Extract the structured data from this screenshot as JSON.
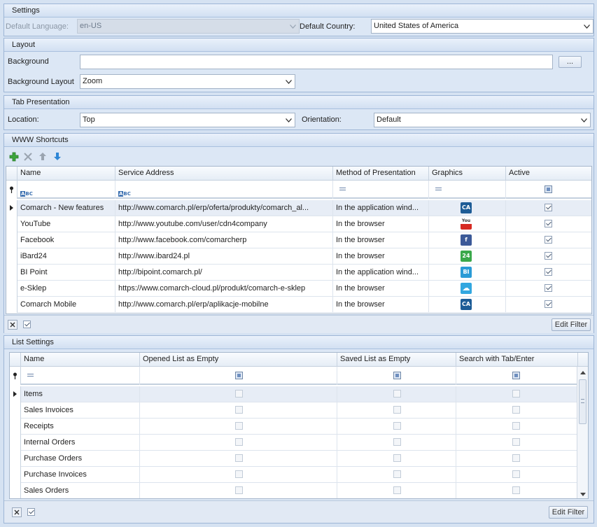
{
  "settings": {
    "header": "Settings",
    "default_language_label": "Default Language:",
    "default_language_value": "en-US",
    "default_country_label": "Default Country:",
    "default_country_value": "United States of America"
  },
  "layout": {
    "header": "Layout",
    "background_label": "Background",
    "background_value": "",
    "browse_label": "...",
    "background_layout_label": "Background Layout",
    "background_layout_value": "Zoom"
  },
  "tab_presentation": {
    "header": "Tab Presentation",
    "location_label": "Location:",
    "location_value": "Top",
    "orientation_label": "Orientation:",
    "orientation_value": "Default"
  },
  "www_shortcuts": {
    "header": "WWW Shortcuts",
    "columns": [
      "Name",
      "Service Address",
      "Method of Presentation",
      "Graphics",
      "Active"
    ],
    "rows": [
      {
        "name": "Comarch - New features",
        "address": "http://www.comarch.pl/erp/oferta/produkty/comarch_al...",
        "method": "In the application wind...",
        "icon": "comarch-ca-icon",
        "icon_text": "CA",
        "icon_color": "#1d5c96",
        "active": true
      },
      {
        "name": "YouTube",
        "address": "http://www.youtube.com/user/cdn4company",
        "method": "In the browser",
        "icon": "youtube-icon",
        "icon_text": "You",
        "icon_color": "#d62a22",
        "active": true
      },
      {
        "name": "Facebook",
        "address": "http://www.facebook.com/comarcherp",
        "method": "In the browser",
        "icon": "facebook-icon",
        "icon_text": "f",
        "icon_color": "#3b5998",
        "active": true
      },
      {
        "name": "iBard24",
        "address": "http://www.ibard24.pl",
        "method": "In the browser",
        "icon": "ibard24-icon",
        "icon_text": "24",
        "icon_color": "#3aa84a",
        "active": true
      },
      {
        "name": "BI Point",
        "address": "http://bipoint.comarch.pl/",
        "method": "In the application wind...",
        "icon": "bi-point-icon",
        "icon_text": "BI",
        "icon_color": "#2a9bd6",
        "active": true
      },
      {
        "name": "e-Sklep",
        "address": "https://www.comarch-cloud.pl/produkt/comarch-e-sklep",
        "method": "In the browser",
        "icon": "cloud-icon",
        "icon_text": "☁",
        "icon_color": "#32a7e0",
        "active": true
      },
      {
        "name": "Comarch Mobile",
        "address": "http://www.comarch.pl/erp/aplikacje-mobilne",
        "method": "In the browser",
        "icon": "comarch-ca-icon",
        "icon_text": "CA",
        "icon_color": "#1d5c96",
        "active": true
      }
    ],
    "edit_filter_label": "Edit Filter"
  },
  "list_settings": {
    "header": "List Settings",
    "columns": [
      "Name",
      "Opened List as Empty",
      "Saved List as Empty",
      "Search with Tab/Enter"
    ],
    "rows": [
      {
        "name": "Items"
      },
      {
        "name": "Sales Invoices"
      },
      {
        "name": "Receipts"
      },
      {
        "name": "Internal Orders"
      },
      {
        "name": "Purchase Orders"
      },
      {
        "name": "Purchase Invoices"
      },
      {
        "name": "Sales Orders"
      }
    ],
    "edit_filter_label": "Edit Filter"
  }
}
